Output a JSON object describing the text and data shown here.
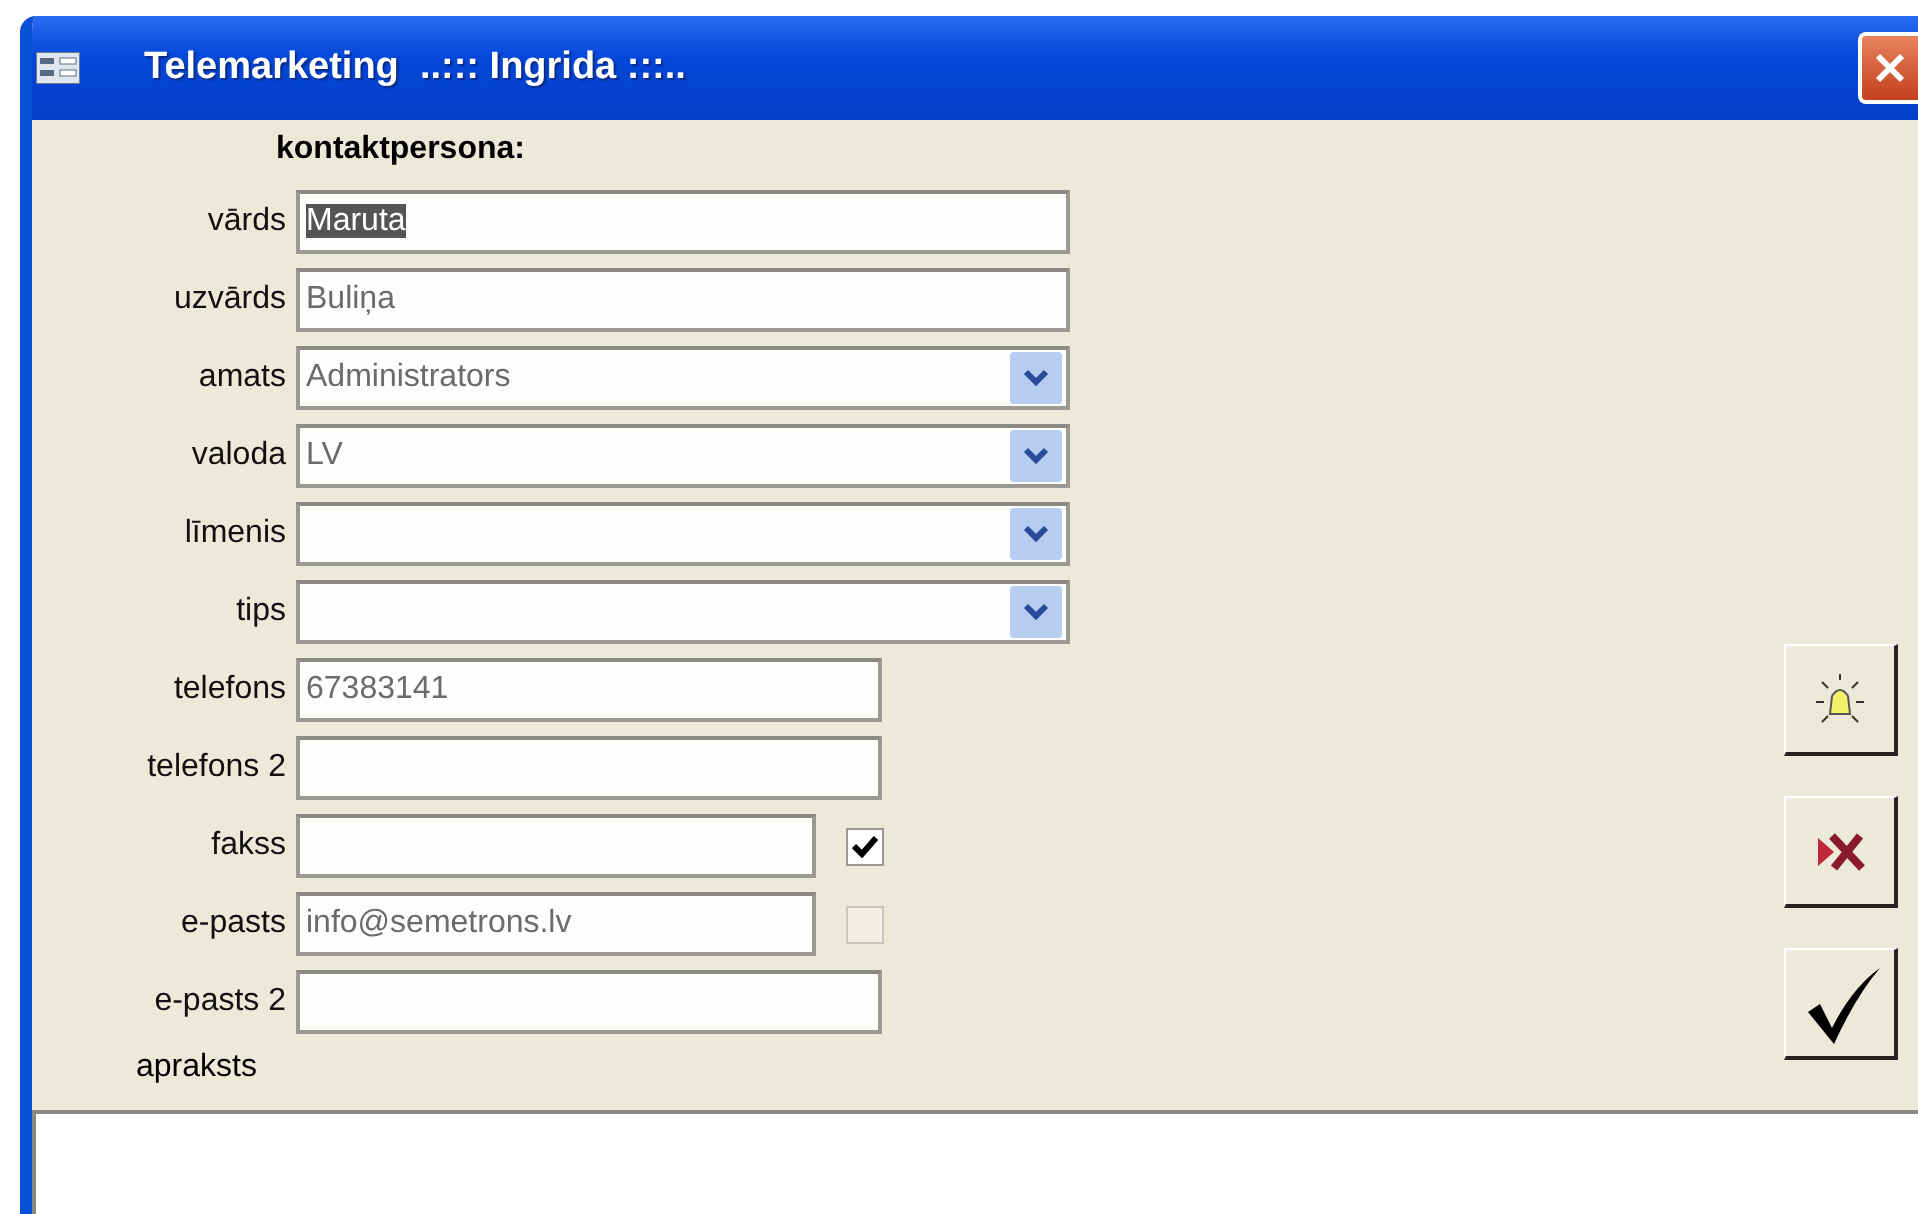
{
  "window": {
    "title": "Telemarketing  ..::: Ingrida :::.."
  },
  "section_heading": "kontaktpersona:",
  "fields": [
    {
      "label": "vārds",
      "kind": "long-text",
      "value": "Maruta",
      "highlighted": true
    },
    {
      "label": "uzvārds",
      "kind": "long-text",
      "value": "Buliņa",
      "highlighted": false
    },
    {
      "label": "amats",
      "kind": "combo",
      "value": "Administrators",
      "highlighted": false
    },
    {
      "label": "valoda",
      "kind": "combo",
      "value": "LV",
      "highlighted": false
    },
    {
      "label": "līmenis",
      "kind": "combo"
    },
    {
      "label": "tips",
      "kind": "combo"
    },
    {
      "label": "telefons",
      "kind": "text",
      "value": "67383141",
      "highlighted": false
    },
    {
      "label": "telefons 2",
      "kind": "text"
    },
    {
      "label": "fakss",
      "kind": "checked-text",
      "checked": true
    },
    {
      "label": "e-pasts",
      "kind": "checked-text",
      "value": "info@semetrons.lv",
      "checked": false,
      "highlighted": false
    },
    {
      "label": "e-pasts 2",
      "kind": "text"
    }
  ],
  "description": {
    "label": "apraksts"
  },
  "buttons": [
    {
      "kind": "new"
    },
    {
      "kind": "delete"
    },
    {
      "kind": "ok"
    }
  ]
}
